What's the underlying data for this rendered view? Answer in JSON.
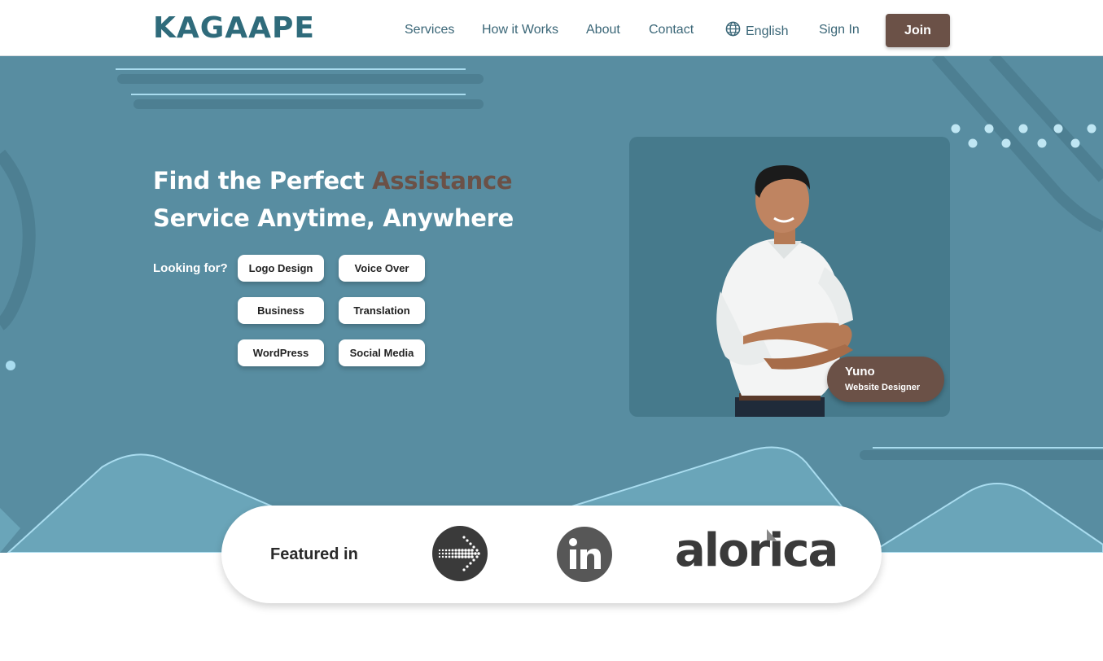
{
  "header": {
    "logo_text": "KAGAAPE",
    "nav": {
      "services": "Services",
      "how_it_works": "How it Works",
      "about": "About",
      "contact": "Contact",
      "language": "English",
      "sign_in": "Sign In",
      "join": "Join"
    }
  },
  "hero": {
    "headline_part1": "Find the Perfect ",
    "headline_accent": "Assistance",
    "headline_part2": "Service Anytime, Anywhere",
    "looking_for_label": "Looking for?",
    "categories": [
      "Logo Design",
      "Voice Over",
      "Business",
      "Translation",
      "WordPress",
      "Social Media"
    ],
    "profile": {
      "name": "Yuno",
      "role": "Website Designer"
    }
  },
  "featured": {
    "label": "Featured in",
    "logos": [
      "arrow-dots-logo",
      "linkedin-logo",
      "alorica-logo"
    ],
    "alorica_text": "alorica"
  },
  "colors": {
    "brand_teal": "#2f6b7b",
    "hero_bg": "#588da1",
    "accent_brown": "#6b5147",
    "card_bg": "#467a8c"
  }
}
